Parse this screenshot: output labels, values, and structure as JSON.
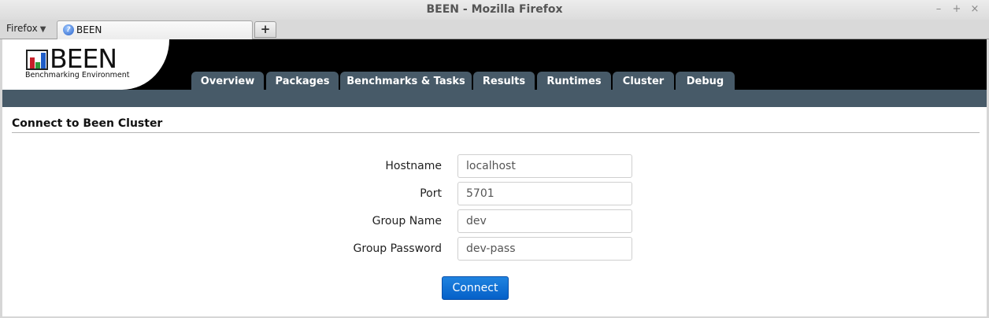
{
  "window": {
    "title": "BEEN - Mozilla Firefox",
    "controls": {
      "minimize": "–",
      "maximize": "+",
      "close": "×"
    }
  },
  "browser": {
    "menu_label": "Firefox",
    "menu_arrow": "▼",
    "tab_label": "BEEN",
    "newtab_label": "+"
  },
  "app": {
    "logo_text": "BEEN",
    "logo_subtitle": "Benchmarking Environment",
    "logo_bar_colors": [
      "#c8202a",
      "#2f9a3a",
      "#1f5cc6"
    ],
    "nav": [
      {
        "label": "Overview"
      },
      {
        "label": "Packages"
      },
      {
        "label": "Benchmarks & Tasks"
      },
      {
        "label": "Results"
      },
      {
        "label": "Runtimes"
      },
      {
        "label": "Cluster"
      },
      {
        "label": "Debug"
      }
    ]
  },
  "page": {
    "section_title": "Connect to Been Cluster",
    "fields": [
      {
        "label": "Hostname",
        "value": "localhost"
      },
      {
        "label": "Port",
        "value": "5701"
      },
      {
        "label": "Group Name",
        "value": "dev"
      },
      {
        "label": "Group Password",
        "value": "dev-pass"
      }
    ],
    "connect_label": "Connect"
  },
  "colors": {
    "nav_bg": "#475a68",
    "header_bg": "#000000",
    "button_blue": "#0a6fd8"
  }
}
